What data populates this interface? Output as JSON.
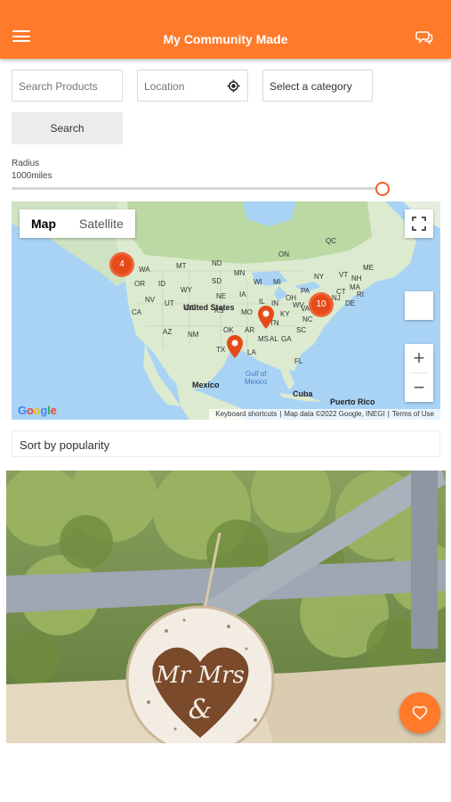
{
  "header": {
    "title": "My Community Made",
    "menu_icon": "menu-icon",
    "chat_icon": "chat-icon"
  },
  "filters": {
    "search_placeholder": "Search Products",
    "location_placeholder": "Location",
    "category_value": "Select a category",
    "search_button": "Search",
    "radius_label": "Radius",
    "radius_value": "1000miles",
    "radius_fraction": 1.0
  },
  "map": {
    "type_map": "Map",
    "type_satellite": "Satellite",
    "clusters": [
      "4",
      "10"
    ],
    "labels": {
      "united_states": "United States",
      "mexico": "Mexico",
      "cuba": "Cuba",
      "puerto_rico": "Puerto Rico",
      "gulf_l1": "Gulf of",
      "gulf_l2": "Mexico",
      "states": [
        "WA",
        "MT",
        "ND",
        "MN",
        "OR",
        "ID",
        "WY",
        "SD",
        "NE",
        "IA",
        "WI",
        "MI",
        "NV",
        "UT",
        "CO",
        "KS",
        "MO",
        "IL",
        "IN",
        "OH",
        "PA",
        "NY",
        "CA",
        "AZ",
        "NM",
        "OK",
        "AR",
        "TN",
        "KY",
        "VA",
        "TX",
        "LA",
        "MS",
        "AL",
        "GA",
        "SC",
        "NC",
        "FL",
        "ME",
        "QC",
        "ON",
        "VT",
        "NH",
        "MA",
        "CT",
        "RI",
        "NJ",
        "DE",
        "MD",
        "WV"
      ]
    },
    "zoom_in": "+",
    "zoom_out": "−",
    "attribution": [
      "Keyboard shortcuts",
      "Map data ©2022 Google, INEGI",
      "Terms of Use"
    ],
    "google_letters": [
      "G",
      "o",
      "o",
      "g",
      "l",
      "e"
    ]
  },
  "sort": {
    "label": "Sort by popularity"
  },
  "product": {
    "image": "mr-mrs-sign-photo",
    "favorite_icon": "heart-icon"
  },
  "colors": {
    "accent": "#ff7a2b",
    "cluster": "#e64a19"
  }
}
